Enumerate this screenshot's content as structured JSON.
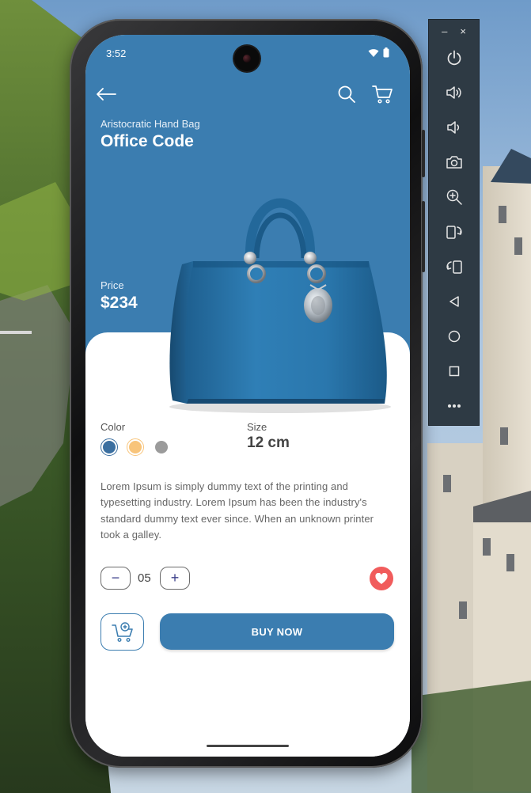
{
  "status_bar": {
    "time": "3:52"
  },
  "product": {
    "subtitle": "Aristocratic Hand Bag",
    "name": "Office Code",
    "price_label": "Price",
    "price": "$234",
    "color_label": "Color",
    "size_label": "Size",
    "size_value": "12 cm",
    "colors": [
      "#3b6fa0",
      "#f8c47a",
      "#9b9b9b"
    ],
    "selected_color_index": 0,
    "description": "Lorem Ipsum is simply dummy text of the printing and typesetting industry. Lorem Ipsum has been the industry's standard dummy text ever since. When an unknown printer took a galley."
  },
  "quantity": {
    "minus": "−",
    "value": "05",
    "plus": "+"
  },
  "actions": {
    "buy_now": "BUY NOW"
  },
  "theme": {
    "primary": "#3b7db0",
    "favorite": "#f15c5c"
  },
  "icons": {
    "back": "arrow-left-icon",
    "search": "search-icon",
    "cart": "cart-icon",
    "favorite": "heart-icon",
    "add_to_cart": "cart-plus-icon"
  },
  "emulator_toolbar": {
    "minimize": "–",
    "close": "×",
    "buttons": [
      "power-icon",
      "volume-up-icon",
      "volume-down-icon",
      "camera-icon",
      "zoom-in-icon",
      "rotate-right-icon",
      "rotate-left-icon",
      "back-triangle-icon",
      "home-circle-icon",
      "overview-square-icon",
      "more-icon"
    ]
  }
}
